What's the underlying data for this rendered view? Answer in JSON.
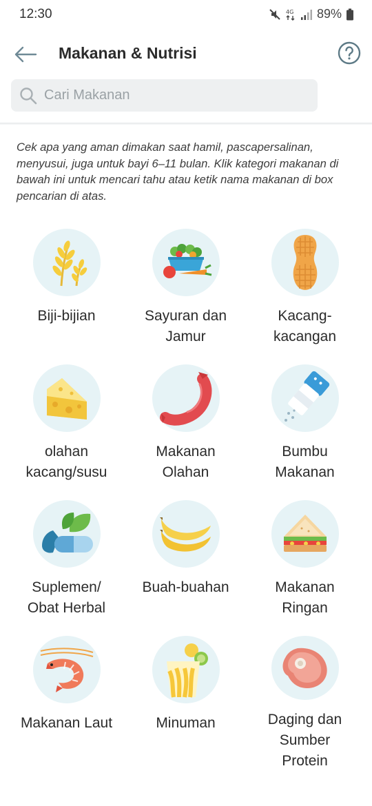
{
  "status_bar": {
    "time": "12:30",
    "battery": "89%"
  },
  "header": {
    "title": "Makanan & Nutrisi",
    "back_icon": "arrow-left-icon",
    "help_icon": "question-circle-icon"
  },
  "search": {
    "placeholder": "Cari Makanan",
    "value": ""
  },
  "intro_text": "Cek apa yang aman dimakan saat hamil, pascapersalinan, menyusui, juga untuk bayi 6–11 bulan. Klik kategori makanan di bawah ini untuk mencari tahu atau ketik nama makanan di box pencarian di atas.",
  "colors": {
    "icon_bg": "#e6f3f6",
    "accent": "#4a7f8c"
  },
  "categories": [
    {
      "label": "Biji-bijian",
      "icon": "grain-icon"
    },
    {
      "label": "Sayuran dan\nJamur",
      "icon": "vegetable-basket-icon"
    },
    {
      "label": "Kacang-\nkacangan",
      "icon": "peanut-icon"
    },
    {
      "label": "olahan\nkacang/susu",
      "icon": "cheese-icon"
    },
    {
      "label": "Makanan\nOlahan",
      "icon": "sausage-icon"
    },
    {
      "label": "Bumbu\nMakanan",
      "icon": "salt-shaker-icon"
    },
    {
      "label": "Suplemen/\nObat Herbal",
      "icon": "capsule-leaf-icon"
    },
    {
      "label": "Buah-buahan",
      "icon": "banana-icon"
    },
    {
      "label": "Makanan\nRingan",
      "icon": "sandwich-icon"
    },
    {
      "label": "Makanan Laut",
      "icon": "shrimp-icon"
    },
    {
      "label": "Minuman",
      "icon": "drink-cup-icon"
    },
    {
      "label": "Daging dan\nSumber\nProtein",
      "icon": "meat-steak-icon"
    }
  ]
}
